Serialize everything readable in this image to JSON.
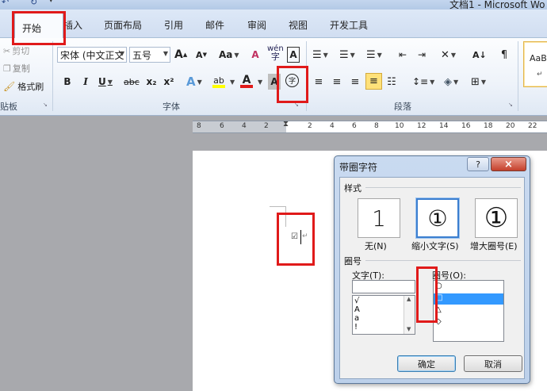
{
  "titlebar": {
    "title": "文档1 - Microsoft Wo"
  },
  "tabs": [
    {
      "label": "开始"
    },
    {
      "label": "插入"
    },
    {
      "label": "页面布局"
    },
    {
      "label": "引用"
    },
    {
      "label": "邮件"
    },
    {
      "label": "审阅"
    },
    {
      "label": "视图"
    },
    {
      "label": "开发工具"
    }
  ],
  "clipboard": {
    "cut": "剪切",
    "copy": "复制",
    "format_painter": "格式刷",
    "group_label": "贴板"
  },
  "font": {
    "name": "宋体 (中文正文",
    "size": "五号",
    "grow": "A",
    "shrink": "A",
    "case": "Aa",
    "clear": "A",
    "phonetic": "wén",
    "border": "A",
    "bold": "B",
    "italic": "I",
    "underline": "U",
    "strike": "abc",
    "sub": "x₂",
    "sup": "x²",
    "effects": "A",
    "highlight": "ab",
    "color": "A",
    "shading": "A",
    "enclose": "字",
    "group_label": "字体"
  },
  "paragraph": {
    "group_label": "段落"
  },
  "styles": {
    "preview": "AaB"
  },
  "ruler": {
    "ticks": [
      "8",
      "6",
      "4",
      "2",
      "2",
      "4",
      "6",
      "8",
      "10",
      "12",
      "14",
      "16",
      "18",
      "20",
      "22"
    ]
  },
  "document": {
    "glyph": "☑"
  },
  "dialog": {
    "title": "带圈字符",
    "help": "?",
    "close": "×",
    "style_section": "样式",
    "styles": [
      {
        "preview": "1",
        "label": "无(N)"
      },
      {
        "preview": "①",
        "label": "缩小文字(S)"
      },
      {
        "preview": "①",
        "label": "增大圈号(E)"
      }
    ],
    "enclosure_section": "圈号",
    "text_label": "文字(T):",
    "enclosure_label": "圈号(O):",
    "text_input": "",
    "text_options": [
      "√",
      "A",
      "a",
      "!"
    ],
    "enclosure_options": [
      "○",
      "□",
      "△",
      "◇"
    ],
    "selected_enclosure": 1,
    "ok": "确定",
    "cancel": "取消"
  },
  "colors": {
    "accent": "#e01a1a",
    "selection": "#3399ff",
    "highlight_yellow": "#ffff00",
    "font_red": "#e01a1a"
  }
}
